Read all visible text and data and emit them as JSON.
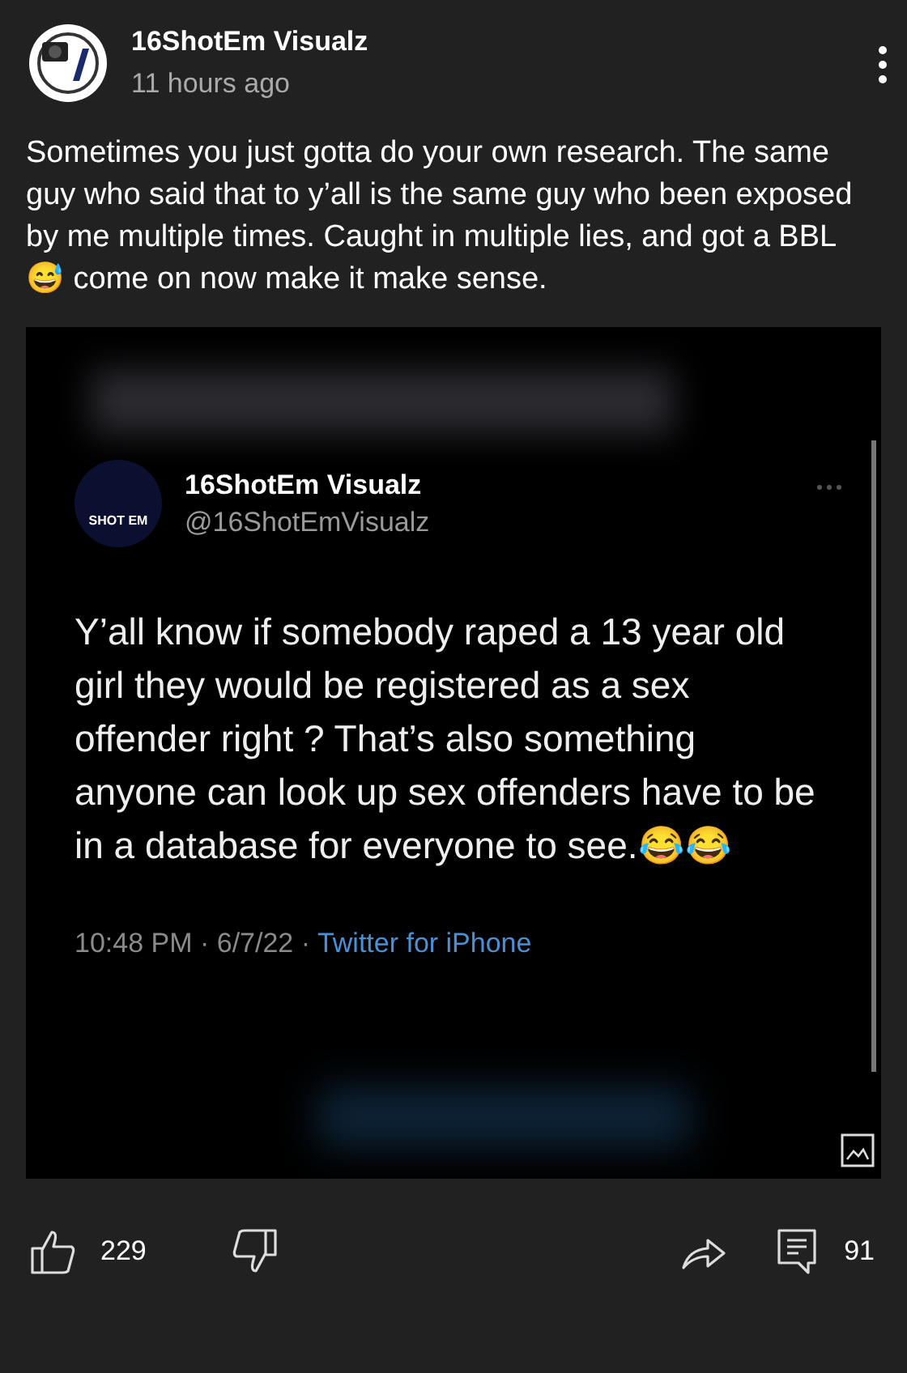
{
  "post": {
    "channel": "16ShotEm Visualz",
    "time": "11 hours ago",
    "text": "Sometimes you just gotta do your own research. The same guy who said that to y’all is the same guy who been exposed by me multiple times. Caught in multiple lies, and got a BBL 😅 come on now make it make sense."
  },
  "tweet": {
    "avatar_label": "SHOT EM",
    "name": "16ShotEm Visualz",
    "handle": "@16ShotEmVisualz",
    "text": "Y’all know if somebody raped a 13 year old girl they would be registered as a sex offender right ?  That’s also something anyone can look up sex offenders have to be in a database for everyone to see.😂😂",
    "time": "10:48 PM · 6/7/22 · ",
    "source": "Twitter for iPhone"
  },
  "actions": {
    "likes": "229",
    "comments": "91"
  }
}
